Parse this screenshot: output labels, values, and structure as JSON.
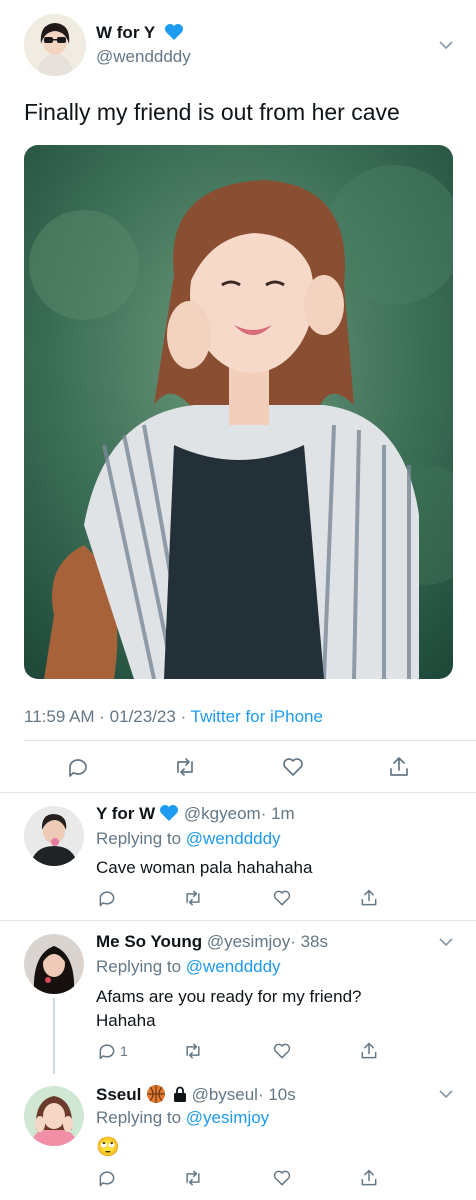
{
  "colors": {
    "accent": "#1d9bf0",
    "gray": "#657786",
    "heart": "#1d9bf0"
  },
  "main_tweet": {
    "display_name": "W for Y",
    "handle": "@wenddddy",
    "text": "Finally my friend is out from her cave",
    "time": "11:59 AM · 01/23/23 ·",
    "source": "Twitter for iPhone"
  },
  "replies": [
    {
      "display_name": "Y for W",
      "handle": "@kgyeom",
      "time": "· 1m",
      "replying_label": "Replying to",
      "replying_to": "@wenddddy",
      "text": "Cave woman pala hahahaha",
      "reply_count": ""
    },
    {
      "display_name": "Me So Young",
      "handle": "@yesimjoy",
      "time": "· 38s",
      "replying_label": "Replying to",
      "replying_to": "@wenddddy",
      "text_line1": "Afams are you ready for my friend?",
      "text_line2": "Hahaha",
      "reply_count": "1"
    },
    {
      "display_name": "Sseul",
      "handle": "@byseul",
      "time": "· 10s",
      "replying_label": "Replying to",
      "replying_to": "@yesimjoy",
      "text": "🙄",
      "reply_count": ""
    }
  ]
}
